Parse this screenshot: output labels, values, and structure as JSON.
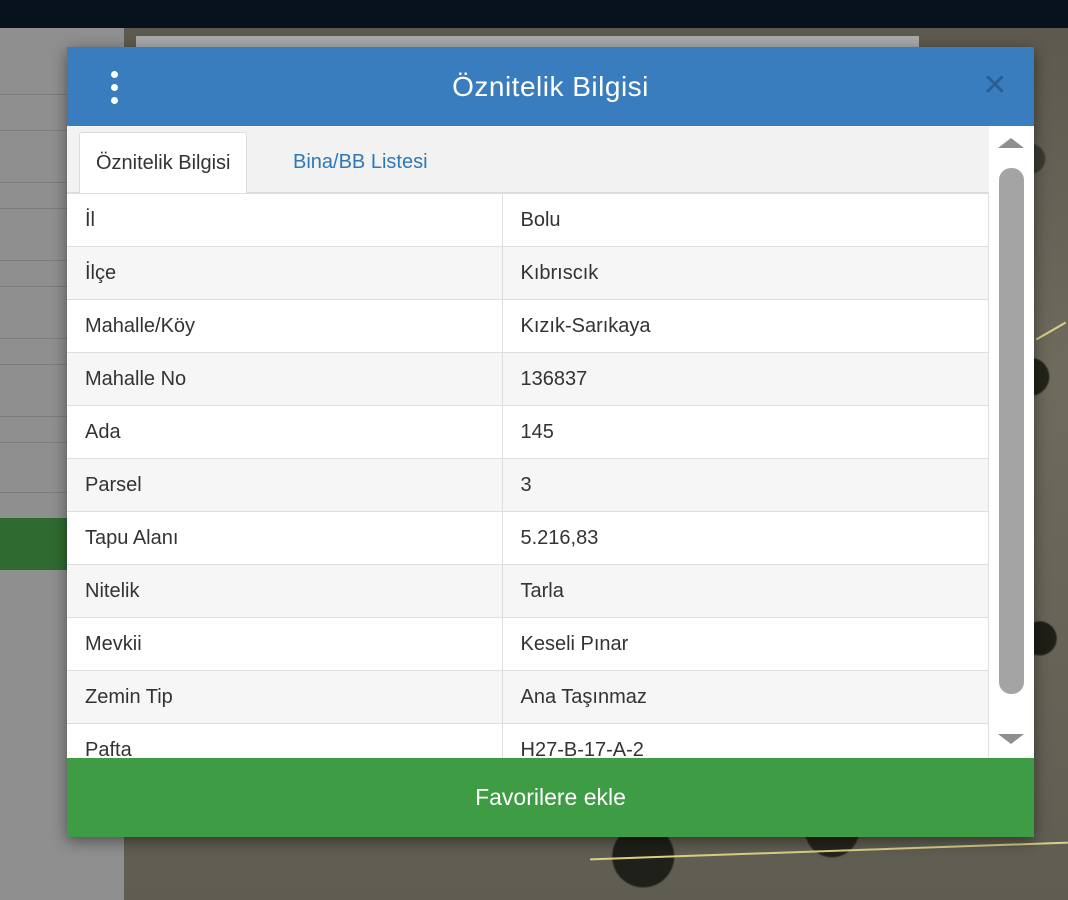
{
  "modal": {
    "title": "Öznitelik Bilgisi",
    "close_symbol": "✕",
    "menu_icon": "vertical-dots-icon"
  },
  "tabs": [
    {
      "label": "Öznitelik Bilgisi",
      "active": true
    },
    {
      "label": "Bina/BB Listesi",
      "active": false
    }
  ],
  "attributes": [
    {
      "key": "İl",
      "value": "Bolu"
    },
    {
      "key": "İlçe",
      "value": "Kıbrıscık"
    },
    {
      "key": "Mahalle/Köy",
      "value": "Kızık-Sarıkaya"
    },
    {
      "key": "Mahalle No",
      "value": "136837"
    },
    {
      "key": "Ada",
      "value": "145"
    },
    {
      "key": "Parsel",
      "value": "3"
    },
    {
      "key": "Tapu Alanı",
      "value": "5.216,83"
    },
    {
      "key": "Nitelik",
      "value": "Tarla"
    },
    {
      "key": "Mevkii",
      "value": "Keseli Pınar"
    },
    {
      "key": "Zemin Tip",
      "value": "Ana Taşınmaz"
    },
    {
      "key": "Pafta",
      "value": "H27-B-17-A-2"
    }
  ],
  "footer": {
    "favorite_label": "Favorilere ekle"
  },
  "colors": {
    "header": "#3a7dbf",
    "favorite_button": "#3e9c45",
    "tab_link": "#2f78b7"
  }
}
